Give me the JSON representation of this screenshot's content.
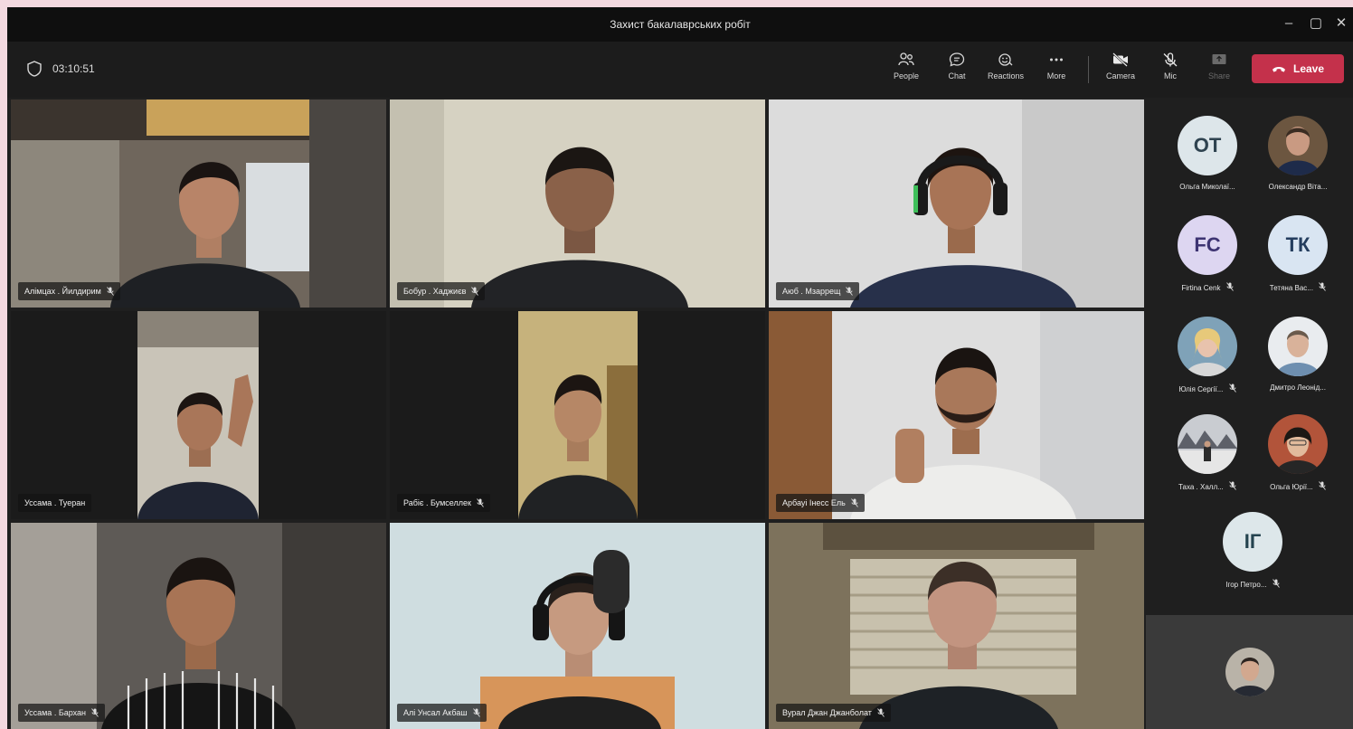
{
  "window": {
    "title": "Захист бакалаврських робіт",
    "minimize_glyph": "–",
    "maximize_glyph": "▢",
    "close_glyph": "✕"
  },
  "toolbar": {
    "timer": "03:10:51",
    "shield_icon": "shield-icon",
    "people_label": "People",
    "chat_label": "Chat",
    "reactions_label": "Reactions",
    "more_label": "More",
    "camera_label": "Camera",
    "mic_label": "Mic",
    "share_label": "Share",
    "leave_label": "Leave",
    "leave_color": "#c4314b"
  },
  "tiles": [
    {
      "name": "Алімцах . Йилдирим"
    },
    {
      "name": "Бобур . Хаджиєв"
    },
    {
      "name": "Аюб . Мзаррещ"
    },
    {
      "name": "Уссама . Туеран"
    },
    {
      "name": "Рабіє . Бумселлек"
    },
    {
      "name": "Арбауі Інесс Ель"
    },
    {
      "name": "Уссама . Бархан"
    },
    {
      "name": "Алі Унсал Акбаш"
    },
    {
      "name": "Вурал Джан Джанболат"
    }
  ],
  "participants": [
    {
      "initials": "ОТ",
      "name": "Ольга Миколаї...",
      "color": "#dde6ea"
    },
    {
      "initials": "",
      "name": "Олександр Віта..."
    },
    {
      "initials": "FC",
      "name": "Firtina Cenk",
      "color": "#ddd6f1"
    },
    {
      "initials": "ТК",
      "name": "Тетяна Вас...",
      "color": "#d9e5f2"
    },
    {
      "initials": "",
      "name": "Юлія Сергії..."
    },
    {
      "initials": "",
      "name": "Дмитро Леонід..."
    },
    {
      "initials": "",
      "name": "Таха . Халл..."
    },
    {
      "initials": "",
      "name": "Ольга Юрії..."
    },
    {
      "initials": "ІГ",
      "name": "Ігор Петро...",
      "color": "#dde7ea"
    }
  ],
  "accent_color": "#7f85f5"
}
